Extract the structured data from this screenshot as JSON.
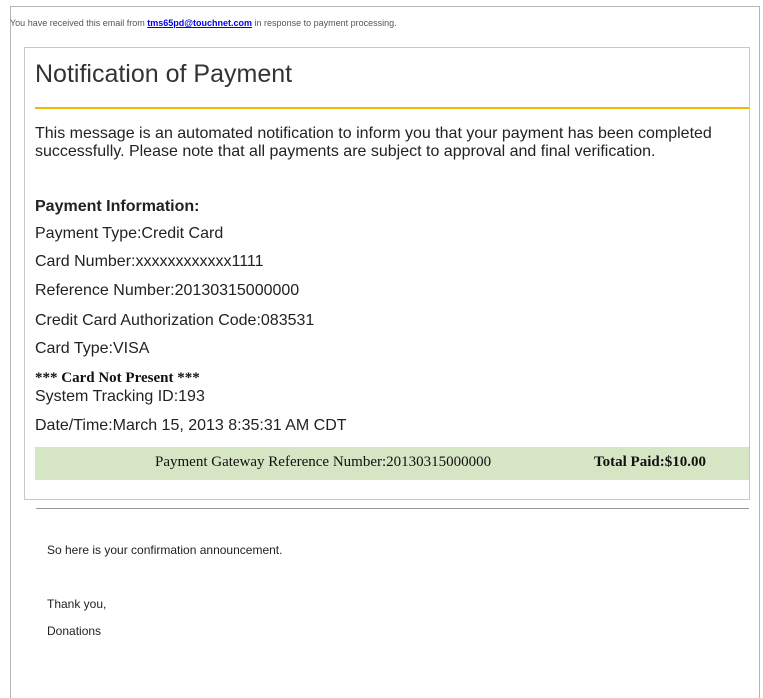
{
  "notice": {
    "prefix": "You have received this email from ",
    "sender_email": "tms65pd@touchnet.com",
    "suffix": " in response to payment processing."
  },
  "notification": {
    "title": "Notification of Payment",
    "message": "This message is an automated notification to inform you that your payment has been completed successfully. Please note that all payments are subject to approval and final verification.",
    "payment_info_heading": "Payment Information:",
    "payment_type": "Payment Type:Credit Card",
    "card_number": "Card Number:xxxxxxxxxxxx1111",
    "reference_number": "Reference Number:20130315000000",
    "auth_code": "Credit Card Authorization Code:083531",
    "card_type": "Card Type:VISA",
    "card_not_present": "*** Card Not Present ***",
    "system_tracking_id": "System Tracking ID:193",
    "date_time": "Date/Time:March 15, 2013 8:35:31 AM CDT",
    "gateway_reference": "Payment Gateway Reference Number:20130315000000",
    "total_paid": "Total Paid:$10.00"
  },
  "footer": {
    "confirmation": "So here is your confirmation announcement.",
    "thanks": "Thank you,",
    "signature": "Donations"
  },
  "colors": {
    "title_rule": "#f0b800",
    "total_bar": "#d6e5c4",
    "link": "#0000ee"
  }
}
